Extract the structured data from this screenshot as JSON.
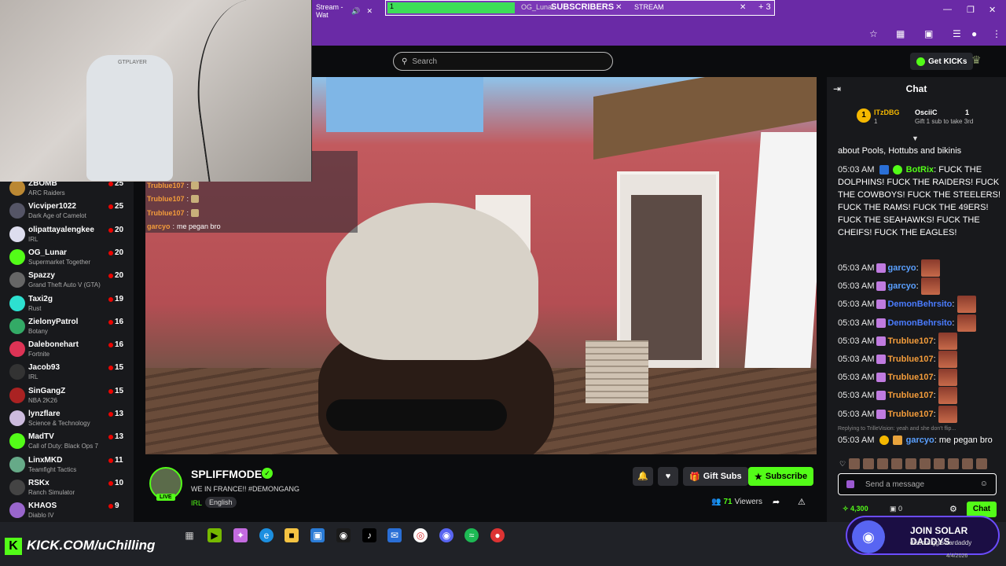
{
  "browser": {
    "tab_watch": "Stream - Wat",
    "tab_green": "1",
    "tab_og": "OG_Lunar",
    "subscribers_label": "SUBSCRIBERS",
    "tab_stream": "STREAM",
    "tab_plus": "+ 3"
  },
  "header": {
    "search_placeholder": "Search",
    "get_kicks": "Get KICKs"
  },
  "webcam": {
    "chair_brand": "GTPLAYER"
  },
  "sidebar": {
    "channels": [
      {
        "name": "ZBOMB",
        "category": "ARC Raiders",
        "viewers": "25",
        "color": "#b83"
      },
      {
        "name": "Vicviper1022",
        "category": "Dark Age of Camelot",
        "viewers": "25",
        "color": "#556"
      },
      {
        "name": "olipattayalengkee",
        "category": "IRL",
        "viewers": "20",
        "color": "#dde"
      },
      {
        "name": "OG_Lunar",
        "category": "Supermarket Together",
        "viewers": "20",
        "color": "#53fc18"
      },
      {
        "name": "Spazzy",
        "category": "Grand Theft Auto V (GTA)",
        "viewers": "20",
        "color": "#666"
      },
      {
        "name": "Taxi2g",
        "category": "Rust",
        "viewers": "19",
        "color": "#2de0d0"
      },
      {
        "name": "ZielonyPatrol",
        "category": "Botany",
        "viewers": "16",
        "color": "#3a6"
      },
      {
        "name": "Dalebonehart",
        "category": "Fortnite",
        "viewers": "16",
        "color": "#d35"
      },
      {
        "name": "Jacob93",
        "category": "IRL",
        "viewers": "15",
        "color": "#333"
      },
      {
        "name": "SinGangZ",
        "category": "NBA 2K26",
        "viewers": "15",
        "color": "#a22"
      },
      {
        "name": "lynzflare",
        "category": "Science & Technology",
        "viewers": "13",
        "color": "#cbd"
      },
      {
        "name": "MadTV",
        "category": "Call of Duty: Black Ops 7",
        "viewers": "13",
        "color": "#53fc18"
      },
      {
        "name": "LinxMKD",
        "category": "Teamfight Tactics",
        "viewers": "11",
        "color": "#6a8"
      },
      {
        "name": "RSKx",
        "category": "Ranch Simulator",
        "viewers": "10",
        "color": "#444"
      },
      {
        "name": "KHAOS",
        "category": "Diablo IV",
        "viewers": "9",
        "color": "#96c"
      }
    ]
  },
  "overlay_chat": {
    "rows": [
      {
        "name": "Trublue107",
        "sep": ":",
        "text": ""
      },
      {
        "name": "Trublue107",
        "sep": ":",
        "text": ""
      },
      {
        "name": "Trublue107",
        "sep": ":",
        "text": ""
      },
      {
        "name": "garcyo",
        "sep": ":",
        "text": "me pegan bro"
      }
    ]
  },
  "stream": {
    "streamer": "SPLIFFMODE",
    "live": "LIVE",
    "title": "WE IN FRANCE!! #DEMONGANG",
    "category": "IRL",
    "language": "English",
    "gift_subs": "Gift Subs",
    "subscribe": "Subscribe",
    "viewers_count": "71",
    "viewers_label": "Viewers"
  },
  "chat": {
    "title": "Chat",
    "leaderboard": {
      "first_rank": "1",
      "first_name": "ITzDBG",
      "first_count": "1",
      "second_name": "OsciiC",
      "second_count": "1",
      "gift_text": "Gift 1 sub to take 3rd"
    },
    "prev_line": "about Pools, Hottubs and bikinis",
    "botrix": {
      "time": "05:03 AM",
      "user": "BotRix",
      "text": "FUCK THE DOLPHINS! FUCK THE RAIDERS! FUCK THE COWBOYS! FUCK THE STEELERS! FUCK THE RAMS! FUCK THE 49ERS! FUCK THE SEAHAWKS! FUCK THE CHEIFS! FUCK THE EAGLES!"
    },
    "messages": [
      {
        "time": "05:03 AM",
        "user": "garcyo",
        "color": "#5aa0ff"
      },
      {
        "time": "05:03 AM",
        "user": "garcyo",
        "color": "#5aa0ff"
      },
      {
        "time": "05:03 AM",
        "user": "DemonBehrsito",
        "color": "#4a7cff"
      },
      {
        "time": "05:03 AM",
        "user": "DemonBehrsito",
        "color": "#4a7cff"
      },
      {
        "time": "05:03 AM",
        "user": "Trublue107",
        "color": "#f39c3b"
      },
      {
        "time": "05:03 AM",
        "user": "Trublue107",
        "color": "#f39c3b"
      },
      {
        "time": "05:03 AM",
        "user": "Trublue107",
        "color": "#f39c3b"
      },
      {
        "time": "05:03 AM",
        "user": "Trublue107",
        "color": "#f39c3b"
      },
      {
        "time": "05:03 AM",
        "user": "Trublue107",
        "color": "#f39c3b"
      }
    ],
    "reply_hint": "Replying to TrilleVision: yeah and she don't flip...",
    "last": {
      "time": "05:03 AM",
      "user": "garcyo",
      "text": "me pegan bro"
    },
    "input_placeholder": "Send a message",
    "kicks_count": "4,300",
    "points_count": "0",
    "send_label": "Chat"
  },
  "taskbar": {
    "kick_letter": "K",
    "promo_url": "KICK.COM/uChilling"
  },
  "discord_promo": {
    "title": "JOIN SOLAR DADDYS",
    "link": "discord.gg/solardaddy"
  },
  "tray": {
    "date": "4/4/2026"
  }
}
